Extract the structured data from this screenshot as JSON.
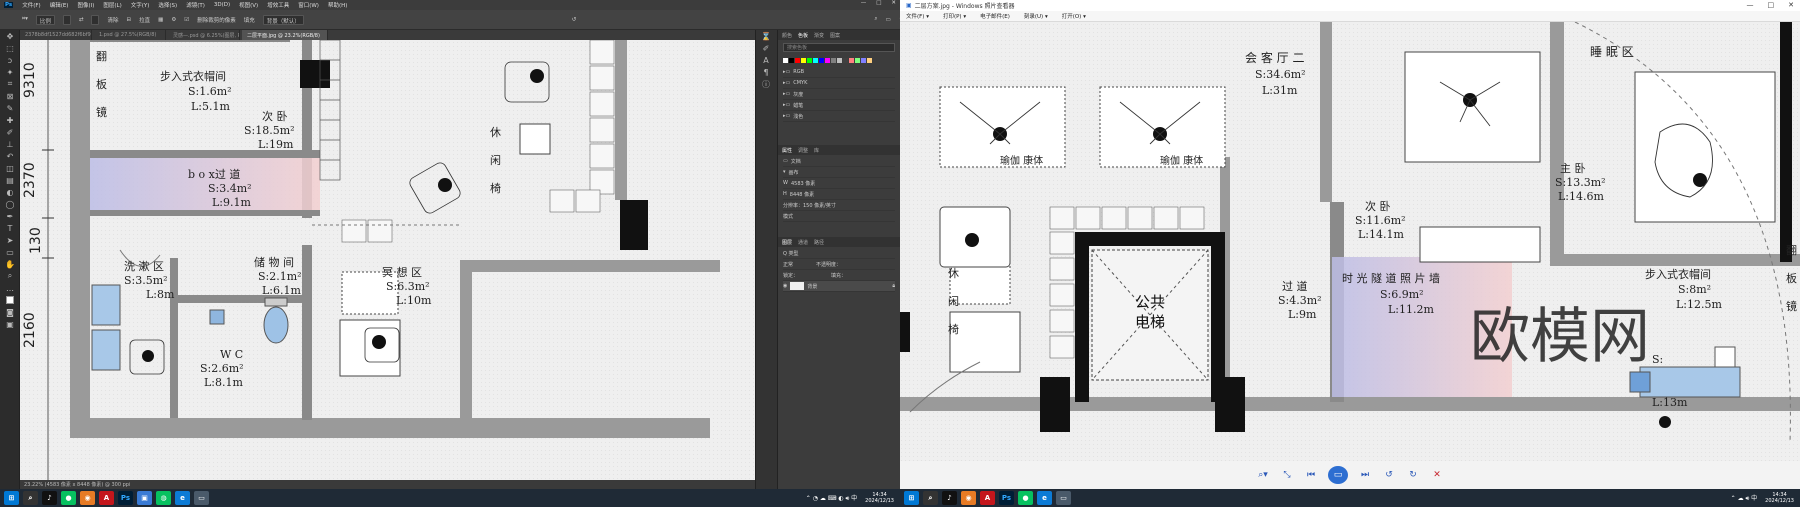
{
  "editor": {
    "menubar": [
      "文件(F)",
      "编辑(E)",
      "图像(I)",
      "图层(L)",
      "文字(Y)",
      "选择(S)",
      "滤镜(T)",
      "3D(D)",
      "视图(V)",
      "增效工具",
      "窗口(W)",
      "帮助(H)"
    ],
    "window_controls": [
      "—",
      "□",
      "✕"
    ],
    "options": {
      "style_value": "比例",
      "swap_label": "清除",
      "straighten_label": "拉直",
      "delete_cropped_label": "删除裁剪的像素",
      "fill_label": "填充",
      "fill_value": "背景（默认）"
    },
    "doc_tabs": [
      "2378b8df1527dd682f6bf9fd7be8f3.jpg @ 8.25%(RGB/8)",
      "1.psd @ 27.5%(RGB/8)",
      "灵感—.psd @ 6.25%(图层, RGB/8)",
      "二层平面.jpg @ 23.2%(RGB/8)"
    ],
    "active_tab_index": 3,
    "status_text": "23.22%  (4583 像素 x 8448 像素)  @ 300 ppi",
    "dimension_labels": [
      "9310",
      "2370",
      "130",
      "2160"
    ],
    "plan_rooms": [
      {
        "name": "步入式衣帽间",
        "area": "S:1.6m²",
        "perimeter": "L:5.1m"
      },
      {
        "name": "次 卧",
        "area": "S:18.5m²",
        "perimeter": "L:19m"
      },
      {
        "name": "b o x过 道",
        "area": "S:3.4m²",
        "perimeter": "L:9.1m"
      },
      {
        "name": "洗 漱 区",
        "area": "S:3.5m²",
        "perimeter": "L:8m"
      },
      {
        "name": "储 物 间",
        "area": "S:2.1m²",
        "perimeter": "L:6.1m"
      },
      {
        "name": "冥 想 区",
        "area": "S:6.3m²",
        "perimeter": "L:10m"
      },
      {
        "name": "W C",
        "area": "S:2.6m²",
        "perimeter": "L:8.1m"
      }
    ],
    "plan_labels": {
      "mirror": "翻\n板\n镜",
      "rest": "休\n闲\n椅"
    },
    "panels": {
      "swatch_tabs": [
        "颜色",
        "色板",
        "渐变",
        "图案"
      ],
      "swatch_active": "色板",
      "search_placeholder": "搜索色板",
      "swatch_groups": [
        "RGB",
        "CMYK",
        "灰度",
        "蜡笔",
        "浅色"
      ],
      "swatch_colors": [
        "#ffffff",
        "#000000",
        "#ff0000",
        "#ffff00",
        "#00ff00",
        "#00ffff",
        "#0000ff",
        "#ff00ff",
        "#808080",
        "#c0c0c0",
        "#404040",
        "#ff8080",
        "#80ff80",
        "#8080ff",
        "#ffd080"
      ],
      "props_tabs": [
        "属性",
        "调整",
        "库"
      ],
      "props_active": "属性",
      "props_doc": "文档",
      "canvas_label": "画布",
      "width_value": "4583 像素",
      "height_value": "8448 像素",
      "resolution_text": "分辨率：150 像素/英寸",
      "mode_label": "模式",
      "layers_tabs": [
        "图层",
        "通道",
        "路径"
      ],
      "layers_active": "图层",
      "layer_kind": "Q 类型",
      "layer_blend": "正常",
      "layer_opacity": "不透明度：",
      "layer_lock": "锁定：",
      "layer_fill": "填充：",
      "layer_name": "背景"
    }
  },
  "viewer": {
    "title": "二层方案.jpg - Windows 照片查看器",
    "window_controls": [
      "—",
      "□",
      "✕"
    ],
    "menu": [
      "文件(F) ▾",
      "打印(P) ▾",
      "电子邮件(E)",
      "刻录(U) ▾",
      "打开(O) ▾"
    ],
    "plan_rooms": [
      {
        "name": "会 客 厅 二",
        "area": "S:34.6m²",
        "perimeter": "L:31m"
      },
      {
        "name": "次 卧",
        "area": "S:11.6m²",
        "perimeter": "L:14.1m"
      },
      {
        "name": "主 卧",
        "area": "S:13.3m²",
        "perimeter": "L:14.6m"
      },
      {
        "name": "过 道",
        "area": "S:4.3m²",
        "perimeter": "L:9m"
      },
      {
        "name": "时 光 隧 道 照 片 墙",
        "area": "S:6.9m²",
        "perimeter": "L:11.2m"
      },
      {
        "name": "步入式衣帽间",
        "area": "S:8m²",
        "perimeter": "L:12.5m"
      }
    ],
    "plan_labels": {
      "sleep": "睡 眠 区",
      "yoga1": "瑜伽 康体",
      "yoga2": "瑜伽 康体",
      "elevator": "公共\n电梯",
      "rest": "休\n闲\n椅",
      "mirror": "翻\n板\n镜",
      "partial_area": "S:",
      "partial_perim": "L:13m"
    },
    "watermark": "欧模网",
    "controls": [
      "zoom",
      "actual-size",
      "previous",
      "slideshow",
      "next",
      "rotate-ccw",
      "rotate-cw",
      "delete"
    ]
  },
  "taskbar_left": {
    "time": "14:34",
    "date": "2024/12/13"
  },
  "taskbar_right": {
    "time": "14:34",
    "date": "2024/12/13"
  }
}
